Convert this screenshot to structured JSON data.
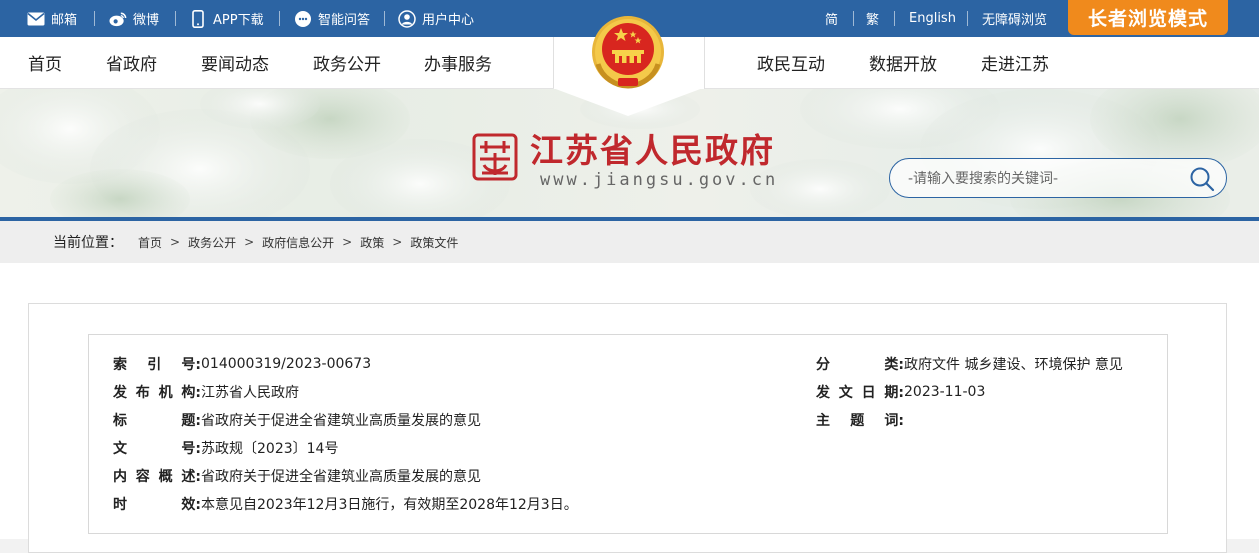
{
  "topbar": {
    "left_items": [
      {
        "label": "邮箱",
        "icon": "mail-icon"
      },
      {
        "label": "微博",
        "icon": "weibo-icon"
      },
      {
        "label": "APP下载",
        "icon": "phone-icon"
      },
      {
        "label": "智能问答",
        "icon": "chat-icon"
      },
      {
        "label": "用户中心",
        "icon": "user-icon"
      }
    ],
    "right_items": [
      "简",
      "繁",
      "English",
      "无障碍浏览"
    ],
    "elder_mode": "长者浏览模式"
  },
  "nav": {
    "left": [
      "首页",
      "省政府",
      "要闻动态",
      "政务公开",
      "办事服务"
    ],
    "right": [
      "政民互动",
      "数据开放",
      "走进江苏"
    ]
  },
  "banner": {
    "title": "江苏省人民政府",
    "url": "www.jiangsu.gov.cn",
    "search_placeholder": "-请输入要搜索的关键词-"
  },
  "breadcrumb": {
    "label": "当前位置：",
    "items": [
      "首页",
      "政务公开",
      "政府信息公开",
      "政策",
      "政策文件"
    ]
  },
  "info": {
    "left": [
      {
        "label": [
          "索",
          "引",
          "号:"
        ],
        "value": "014000319/2023-00673"
      },
      {
        "label": [
          "发",
          "布",
          "机",
          "构:"
        ],
        "value": "江苏省人民政府"
      },
      {
        "label": [
          "标",
          "题:"
        ],
        "value": "省政府关于促进全省建筑业高质量发展的意见"
      },
      {
        "label": [
          "文",
          "号:"
        ],
        "value": "苏政规〔2023〕14号"
      },
      {
        "label": [
          "内",
          "容",
          "概",
          "述:"
        ],
        "value": "省政府关于促进全省建筑业高质量发展的意见"
      },
      {
        "label": [
          "时",
          "效:"
        ],
        "value": "本意见自2023年12月3日施行，有效期至2028年12月3日。"
      }
    ],
    "right": [
      {
        "label": [
          "分",
          "类:"
        ],
        "value": "政府文件 城乡建设、环境保护 意见"
      },
      {
        "label": [
          "发",
          "文",
          "日",
          "期:"
        ],
        "value": "2023-11-03"
      },
      {
        "label": [
          "主",
          "题",
          "词:"
        ],
        "value": ""
      }
    ]
  },
  "colors": {
    "primary_blue": "#2c64a3",
    "elder_orange": "#f08a1c",
    "title_red": "#c0282d"
  }
}
